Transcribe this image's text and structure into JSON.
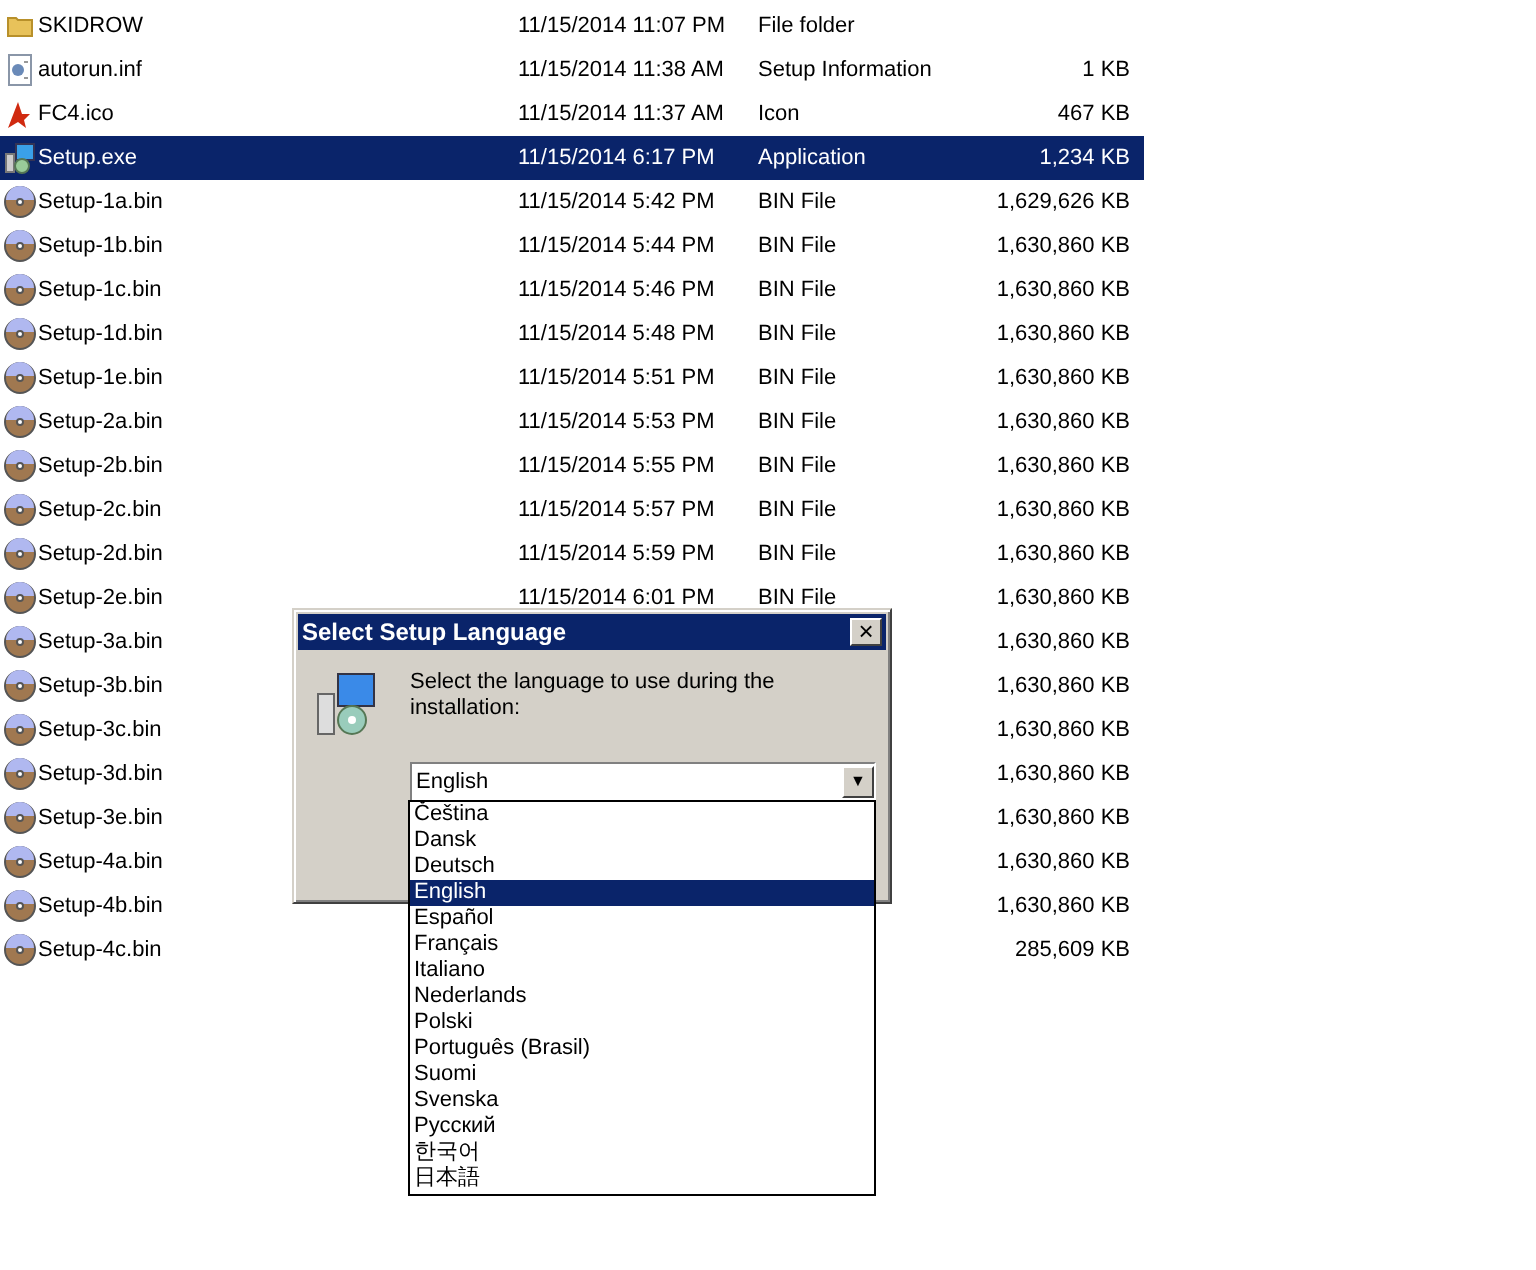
{
  "files": [
    {
      "name": "SKIDROW",
      "kind": "folder",
      "date": "11/15/2014 11:07 PM",
      "type": "File folder",
      "selected": false
    },
    {
      "name": "autorun.inf",
      "kind": "inf",
      "date": "11/15/2014 11:38 AM",
      "type": "Setup Information",
      "size": "1 KB",
      "selected": false
    },
    {
      "name": "FC4.ico",
      "kind": "ico",
      "date": "11/15/2014 11:37 AM",
      "type": "Icon",
      "size": "467 KB",
      "selected": false
    },
    {
      "name": "Setup.exe",
      "kind": "exe",
      "date": "11/15/2014 6:17 PM",
      "type": "Application",
      "size": "1,234 KB",
      "selected": true
    },
    {
      "name": "Setup-1a.bin",
      "kind": "bin",
      "date": "11/15/2014 5:42 PM",
      "type": "BIN File",
      "size": "1,629,626 KB",
      "selected": false
    },
    {
      "name": "Setup-1b.bin",
      "kind": "bin",
      "date": "11/15/2014 5:44 PM",
      "type": "BIN File",
      "size": "1,630,860 KB",
      "selected": false
    },
    {
      "name": "Setup-1c.bin",
      "kind": "bin",
      "date": "11/15/2014 5:46 PM",
      "type": "BIN File",
      "size": "1,630,860 KB",
      "selected": false
    },
    {
      "name": "Setup-1d.bin",
      "kind": "bin",
      "date": "11/15/2014 5:48 PM",
      "type": "BIN File",
      "size": "1,630,860 KB",
      "selected": false
    },
    {
      "name": "Setup-1e.bin",
      "kind": "bin",
      "date": "11/15/2014 5:51 PM",
      "type": "BIN File",
      "size": "1,630,860 KB",
      "selected": false
    },
    {
      "name": "Setup-2a.bin",
      "kind": "bin",
      "date": "11/15/2014 5:53 PM",
      "type": "BIN File",
      "size": "1,630,860 KB",
      "selected": false
    },
    {
      "name": "Setup-2b.bin",
      "kind": "bin",
      "date": "11/15/2014 5:55 PM",
      "type": "BIN File",
      "size": "1,630,860 KB",
      "selected": false
    },
    {
      "name": "Setup-2c.bin",
      "kind": "bin",
      "date": "11/15/2014 5:57 PM",
      "type": "BIN File",
      "size": "1,630,860 KB",
      "selected": false
    },
    {
      "name": "Setup-2d.bin",
      "kind": "bin",
      "date": "11/15/2014 5:59 PM",
      "type": "BIN File",
      "size": "1,630,860 KB",
      "selected": false
    },
    {
      "name": "Setup-2e.bin",
      "kind": "bin",
      "date": "11/15/2014 6:01 PM",
      "type": "BIN File",
      "size": "1,630,860 KB",
      "selected": false
    },
    {
      "name": "Setup-3a.bin",
      "kind": "bin",
      "size": "1,630,860 KB",
      "selected": false
    },
    {
      "name": "Setup-3b.bin",
      "kind": "bin",
      "size": "1,630,860 KB",
      "selected": false
    },
    {
      "name": "Setup-3c.bin",
      "kind": "bin",
      "size": "1,630,860 KB",
      "selected": false
    },
    {
      "name": "Setup-3d.bin",
      "kind": "bin",
      "size": "1,630,860 KB",
      "selected": false
    },
    {
      "name": "Setup-3e.bin",
      "kind": "bin",
      "size": "1,630,860 KB",
      "selected": false
    },
    {
      "name": "Setup-4a.bin",
      "kind": "bin",
      "size": "1,630,860 KB",
      "selected": false
    },
    {
      "name": "Setup-4b.bin",
      "kind": "bin",
      "size": "1,630,860 KB",
      "selected": false
    },
    {
      "name": "Setup-4c.bin",
      "kind": "bin",
      "size": "285,609 KB",
      "selected": false
    }
  ],
  "dialog": {
    "title": "Select Setup Language",
    "close": "×",
    "message": "Select the language to use during the installation:",
    "value": "English",
    "arrow": "▼",
    "options": [
      {
        "label": "Čeština",
        "selected": false
      },
      {
        "label": "Dansk",
        "selected": false
      },
      {
        "label": "Deutsch",
        "selected": false
      },
      {
        "label": "English",
        "selected": true
      },
      {
        "label": "Español",
        "selected": false
      },
      {
        "label": "Français",
        "selected": false
      },
      {
        "label": "Italiano",
        "selected": false
      },
      {
        "label": "Nederlands",
        "selected": false
      },
      {
        "label": "Polski",
        "selected": false
      },
      {
        "label": "Português (Brasil)",
        "selected": false
      },
      {
        "label": "Suomi",
        "selected": false
      },
      {
        "label": "Svenska",
        "selected": false
      },
      {
        "label": "Русский",
        "selected": false
      },
      {
        "label": "한국어",
        "selected": false
      },
      {
        "label": "日本語",
        "selected": false
      }
    ]
  }
}
